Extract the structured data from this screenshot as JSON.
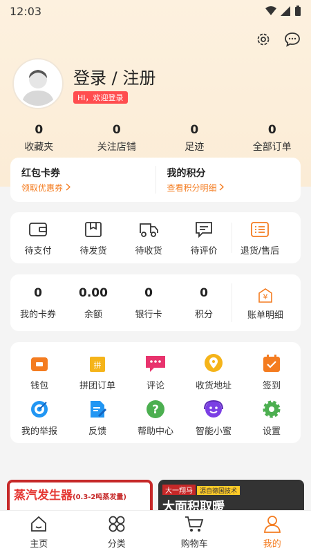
{
  "status": {
    "time": "12:03"
  },
  "profile": {
    "title": "登录 / 注册",
    "badge": "HI，欢迎登录"
  },
  "stats": [
    {
      "value": "0",
      "label": "收藏夹"
    },
    {
      "value": "0",
      "label": "关注店铺"
    },
    {
      "value": "0",
      "label": "足迹"
    },
    {
      "value": "0",
      "label": "全部订单"
    }
  ],
  "coupon": {
    "left": {
      "title": "红包卡券",
      "link": "领取优惠券"
    },
    "right": {
      "title": "我的积分",
      "link": "查看积分明细"
    }
  },
  "orders": [
    {
      "label": "待支付",
      "icon": "wallet-icon"
    },
    {
      "label": "待发货",
      "icon": "box-icon"
    },
    {
      "label": "待收货",
      "icon": "truck-icon"
    },
    {
      "label": "待评价",
      "icon": "comment-icon"
    },
    {
      "label": "退货/售后",
      "icon": "return-list-icon"
    }
  ],
  "wallet": [
    {
      "value": "0",
      "label": "我的卡券"
    },
    {
      "value": "0.00",
      "label": "余额"
    },
    {
      "value": "0",
      "label": "银行卡"
    },
    {
      "value": "0",
      "label": "积分"
    }
  ],
  "bill": {
    "label": "账单明细",
    "glyph": "¥"
  },
  "services": [
    {
      "label": "钱包",
      "icon": "purse-icon",
      "color": "#f47c20"
    },
    {
      "label": "拼团订单",
      "icon": "group-bag-icon",
      "color": "#f5b41a",
      "glyph": "拼"
    },
    {
      "label": "评论",
      "icon": "chat-bubble-icon",
      "color": "#e8336d"
    },
    {
      "label": "收货地址",
      "icon": "location-pin-icon",
      "color": "#f5b41a"
    },
    {
      "label": "签到",
      "icon": "calendar-check-icon",
      "color": "#f47c20"
    },
    {
      "label": "我的举报",
      "icon": "target-icon",
      "color": "#2196f3"
    },
    {
      "label": "反馈",
      "icon": "edit-doc-icon",
      "color": "#2196f3"
    },
    {
      "label": "帮助中心",
      "icon": "help-icon",
      "color": "#4caf50",
      "glyph": "?"
    },
    {
      "label": "智能小蜜",
      "icon": "assistant-icon",
      "color": "#7b3fe4"
    },
    {
      "label": "设置",
      "icon": "gear-icon",
      "color": "#4caf50"
    }
  ],
  "banners": {
    "left": {
      "title": "蒸汽发生器",
      "sub": "(0.3-2吨蒸发量)"
    },
    "right": {
      "tag": "大一翔马",
      "tag2": "源自德国技术",
      "title": "大面积取暖"
    }
  },
  "tabs": [
    {
      "label": "主页",
      "icon": "home-icon"
    },
    {
      "label": "分类",
      "icon": "grid-icon"
    },
    {
      "label": "购物车",
      "icon": "cart-icon"
    },
    {
      "label": "我的",
      "icon": "user-icon",
      "active": true
    }
  ],
  "colors": {
    "accent": "#f47c20",
    "badge": "#ff4d4f",
    "header_bg": "#fdf1df"
  }
}
